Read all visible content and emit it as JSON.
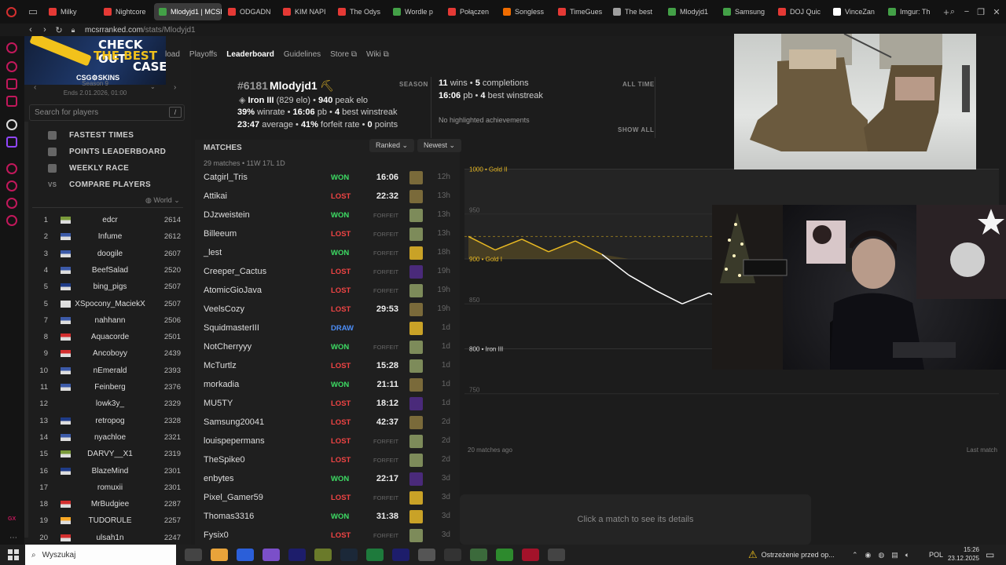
{
  "browser": {
    "tabs": [
      {
        "label": "Milky",
        "color": "#e53935",
        "active": false
      },
      {
        "label": "Nightcore",
        "color": "#e53935",
        "active": false
      },
      {
        "label": "Mlodyjd1 | MCSR",
        "color": "#43a047",
        "active": true
      },
      {
        "label": "ODGADN",
        "color": "#e53935",
        "active": false
      },
      {
        "label": "KIM NAPI",
        "color": "#e53935",
        "active": false
      },
      {
        "label": "The Odys",
        "color": "#e53935",
        "active": false
      },
      {
        "label": "Wordle p",
        "color": "#43a047",
        "active": false
      },
      {
        "label": "Połączen",
        "color": "#e53935",
        "active": false
      },
      {
        "label": "Songless",
        "color": "#ef6c00",
        "active": false
      },
      {
        "label": "TimeGues",
        "color": "#e53935",
        "active": false
      },
      {
        "label": "The best",
        "color": "#9e9e9e",
        "active": false
      },
      {
        "label": "Mlodyjd1",
        "color": "#43a047",
        "active": false
      },
      {
        "label": "Samsung",
        "color": "#43a047",
        "active": false
      },
      {
        "label": "DOJ Quic",
        "color": "#e53935",
        "active": false
      },
      {
        "label": "VinceZan",
        "color": "#ffffff",
        "active": false
      },
      {
        "label": "Imgur: Th",
        "color": "#43a047",
        "active": false
      }
    ],
    "url_host": "mcsrranked.com",
    "url_path": "/stats/Mlodyjd1"
  },
  "ad": {
    "line1": "CHECK OUT",
    "line2": "THE BEST",
    "line3": "CASE",
    "brand": "CSG⚙SKINS"
  },
  "season": {
    "label": "Season 9",
    "ends": "Ends 2.01.2026, 01:00"
  },
  "site_nav": {
    "items": [
      "load",
      "Playoffs",
      "Leaderboard",
      "Guidelines",
      "Store ⧉",
      "Wiki ⧉"
    ],
    "active": "Leaderboard"
  },
  "search": {
    "placeholder": "Search for players",
    "shortcut": "/"
  },
  "left_menu": [
    "FASTEST TIMES",
    "POINTS LEADERBOARD",
    "WEEKLY RACE",
    "COMPARE PLAYERS"
  ],
  "compare_prefix": "VS",
  "region": "World",
  "leaderboard": [
    {
      "rank": "1",
      "name": "edcr",
      "elo": "2614",
      "flag": "#7a9a3a"
    },
    {
      "rank": "2",
      "name": "Infume",
      "elo": "2612",
      "flag": "#3c5aa8"
    },
    {
      "rank": "3",
      "name": "doogile",
      "elo": "2607",
      "flag": "#3c5aa8"
    },
    {
      "rank": "4",
      "name": "BeefSalad",
      "elo": "2520",
      "flag": "#3c5aa8"
    },
    {
      "rank": "5",
      "name": "bing_pigs",
      "elo": "2507",
      "flag": "#1f3c88"
    },
    {
      "rank": "5",
      "name": "XSpocony_MaciekX",
      "elo": "2507",
      "flag": "#e0e0e0"
    },
    {
      "rank": "7",
      "name": "nahhann",
      "elo": "2506",
      "flag": "#3c5aa8"
    },
    {
      "rank": "8",
      "name": "Aquacorde",
      "elo": "2501",
      "flag": "#d32f2f"
    },
    {
      "rank": "9",
      "name": "Ancoboyy",
      "elo": "2439",
      "flag": "#d32f2f"
    },
    {
      "rank": "10",
      "name": "nEmerald",
      "elo": "2393",
      "flag": "#3c5aa8"
    },
    {
      "rank": "11",
      "name": "Feinberg",
      "elo": "2376",
      "flag": "#3c5aa8"
    },
    {
      "rank": "12",
      "name": "lowk3y_",
      "elo": "2329",
      "flag": ""
    },
    {
      "rank": "13",
      "name": "retropog",
      "elo": "2328",
      "flag": "#1f3c88"
    },
    {
      "rank": "14",
      "name": "nyachloe",
      "elo": "2321",
      "flag": "#3c5aa8"
    },
    {
      "rank": "15",
      "name": "DARVY__X1",
      "elo": "2319",
      "flag": "#7a9a3a"
    },
    {
      "rank": "16",
      "name": "BlazeMind",
      "elo": "2301",
      "flag": "#1f3c88"
    },
    {
      "rank": "17",
      "name": "romuxii",
      "elo": "2301",
      "flag": ""
    },
    {
      "rank": "18",
      "name": "MrBudgiee",
      "elo": "2287",
      "flag": "#d32f2f"
    },
    {
      "rank": "19",
      "name": "TUDORULE",
      "elo": "2257",
      "flag": "#f9a825"
    },
    {
      "rank": "20",
      "name": "ulsah1n",
      "elo": "2247",
      "flag": "#d32f2f"
    }
  ],
  "player": {
    "rank": "#6181",
    "name": "Mlodyjd1",
    "tier": "Iron III",
    "elo_text": "829 elo",
    "peak_elo": "940",
    "peak_label": "peak elo",
    "winrate": "39%",
    "winrate_label": "winrate",
    "pb": "16:06",
    "pb_label": "pb",
    "best_winstreak": "4",
    "best_winstreak_label": "best winstreak",
    "average": "23:47",
    "average_label": "average",
    "forfeit_rate": "41%",
    "forfeit_label": "forfeit rate",
    "points": "0",
    "points_label": "points",
    "season_label": "SEASON",
    "all_time_label": "ALL TIME",
    "wins": "11",
    "wins_label": "wins",
    "completions": "5",
    "completions_label": "completions",
    "at_pb": "16:06",
    "at_streak": "4",
    "achievements": "No highlighted achievements",
    "show_all": "SHOW ALL"
  },
  "matches": {
    "title": "MATCHES",
    "filter": "Ranked",
    "sort": "Newest",
    "summary": "29 matches • 11W 17L 1D",
    "rows": [
      {
        "name": "Catgirl_Tris",
        "result": "WON",
        "time": "16:06",
        "ago": "12h",
        "seed": "#7a6a3a"
      },
      {
        "name": "Attikai",
        "result": "LOST",
        "time": "22:32",
        "ago": "13h",
        "seed": "#7a6a3a"
      },
      {
        "name": "DJzweistein",
        "result": "WON",
        "time": "FORFEIT",
        "ago": "13h",
        "seed": "#7d8b5a"
      },
      {
        "name": "Billeeum",
        "result": "LOST",
        "time": "FORFEIT",
        "ago": "13h",
        "seed": "#7d8b5a"
      },
      {
        "name": "_lest",
        "result": "WON",
        "time": "FORFEIT",
        "ago": "18h",
        "seed": "#c9a227"
      },
      {
        "name": "Creeper_Cactus",
        "result": "LOST",
        "time": "FORFEIT",
        "ago": "19h",
        "seed": "#4a2a7a"
      },
      {
        "name": "AtomicGioJava",
        "result": "LOST",
        "time": "FORFEIT",
        "ago": "19h",
        "seed": "#7d8b5a"
      },
      {
        "name": "VeelsCozy",
        "result": "LOST",
        "time": "29:53",
        "ago": "19h",
        "seed": "#7a6a3a"
      },
      {
        "name": "SquidmasterIII",
        "result": "DRAW",
        "time": "",
        "ago": "1d",
        "seed": "#c9a227"
      },
      {
        "name": "NotCherryyy",
        "result": "WON",
        "time": "FORFEIT",
        "ago": "1d",
        "seed": "#7d8b5a"
      },
      {
        "name": "McTurtlz",
        "result": "LOST",
        "time": "15:28",
        "ago": "1d",
        "seed": "#7d8b5a"
      },
      {
        "name": "morkadia",
        "result": "WON",
        "time": "21:11",
        "ago": "1d",
        "seed": "#7a6a3a"
      },
      {
        "name": "MU5TY",
        "result": "LOST",
        "time": "18:12",
        "ago": "1d",
        "seed": "#4a2a7a"
      },
      {
        "name": "Samsung20041",
        "result": "LOST",
        "time": "42:37",
        "ago": "2d",
        "seed": "#7a6a3a"
      },
      {
        "name": "louispepermans",
        "result": "LOST",
        "time": "FORFEIT",
        "ago": "2d",
        "seed": "#7d8b5a"
      },
      {
        "name": "TheSpike0",
        "result": "LOST",
        "time": "FORFEIT",
        "ago": "2d",
        "seed": "#7d8b5a"
      },
      {
        "name": "enbytes",
        "result": "WON",
        "time": "22:17",
        "ago": "3d",
        "seed": "#4a2a7a"
      },
      {
        "name": "Pixel_Gamer59",
        "result": "LOST",
        "time": "FORFEIT",
        "ago": "3d",
        "seed": "#c9a227"
      },
      {
        "name": "Thomas3316",
        "result": "WON",
        "time": "31:38",
        "ago": "3d",
        "seed": "#c9a227"
      },
      {
        "name": "Fysix0",
        "result": "LOST",
        "time": "FORFEIT",
        "ago": "3d",
        "seed": "#7d8b5a"
      }
    ]
  },
  "colors": {
    "won": "#3ddc64",
    "lost": "#ef4444",
    "draw": "#4c8df6",
    "gold": "#e8b923",
    "line": "#ffffff"
  },
  "chart_data": {
    "type": "line",
    "title": "",
    "xlabel": "",
    "ylabel": "",
    "x_start_label": "20 matches ago",
    "x_end_label": "Last match",
    "ylim": [
      700,
      1010
    ],
    "y_ticks": [
      750,
      850,
      950
    ],
    "rank_lines": [
      {
        "value": 1000,
        "label": "1000 • Gold II"
      },
      {
        "value": 900,
        "label": "900 • Gold I"
      },
      {
        "value": 800,
        "label": "800 • Iron III"
      }
    ],
    "threshold_line": 925,
    "values": [
      925,
      910,
      922,
      908,
      920,
      905,
      882,
      865,
      850,
      862,
      848
    ]
  },
  "details_text": "Click a match to see its details",
  "taskbar": {
    "search": "Wyszukaj",
    "warning": "Ostrzeżenie przed op...",
    "lang": "POL",
    "time": "15:26",
    "date": "23.12.2025"
  }
}
